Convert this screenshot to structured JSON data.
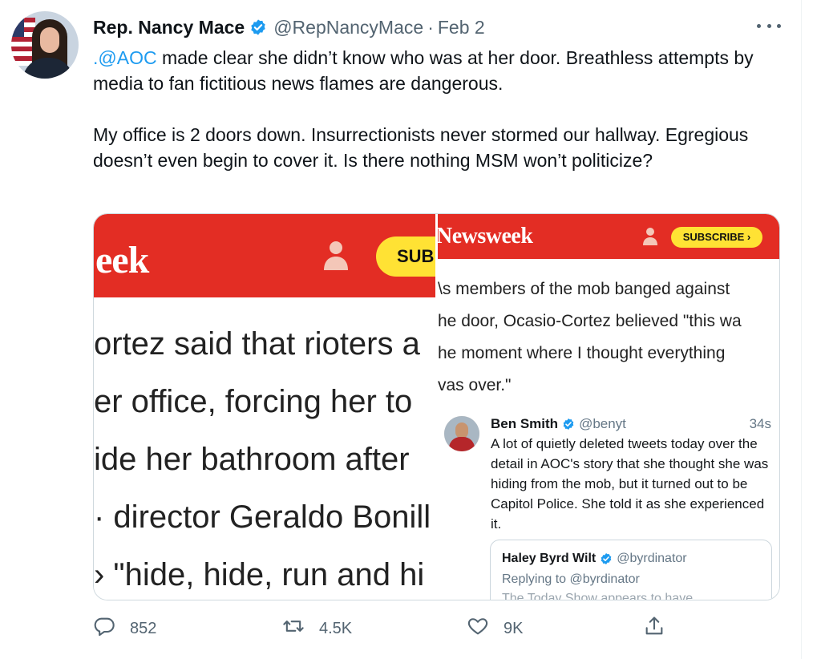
{
  "tweet": {
    "display_name": "Rep. Nancy Mace",
    "handle": "@RepNancyMace",
    "separator": "·",
    "date": "Feb 2",
    "mention": ".@AOC",
    "paragraph1_rest": " made clear she didn’t know who was at her door. Breathless attempts by media to fan fictitious news flames are dangerous.",
    "paragraph2": "My office is 2 doors down. Insurrectionists never stormed our hallway. Egregious doesn’t even begin to cover it. Is there nothing MSM won’t politicize?"
  },
  "media": {
    "left": {
      "logo": "eek",
      "subscribe": "SUB",
      "lines": [
        "ortez said that rioters a",
        "er office, forcing her to",
        "ide her bathroom after",
        "· director Geraldo Bonill",
        "› \"hide, hide, run and hi"
      ]
    },
    "right": {
      "logo": "Newsweek",
      "subscribe": "SUBSCRIBE ›",
      "lines": [
        "\\s members of the mob banged against",
        "he door, Ocasio-Cortez believed \"this wa",
        "he moment where I thought everything",
        "vas over.\""
      ],
      "embed": {
        "name": "Ben Smith",
        "handle": "@benyt",
        "time": "34s",
        "text": "A lot of quietly deleted tweets today over the detail in AOC's story that she thought she was hiding from the mob, but it turned out to be Capitol Police. She told it as she experienced it.",
        "quote": {
          "name": "Haley Byrd Wilt",
          "handle": "@byrdinator",
          "reply": "Replying to @byrdinator",
          "cut_text": "The Today Show appears to have"
        }
      }
    }
  },
  "actions": {
    "reply_count": "852",
    "retweet_count": "4.5K",
    "like_count": "9K",
    "reply_icon": "speech-bubble",
    "retweet_icon": "retweet-arrows",
    "like_icon": "heart-outline",
    "share_icon": "share-upload"
  },
  "colors": {
    "verified_blue": "#1d9bf0",
    "newsweek_red": "#e32d24",
    "subscribe_yellow": "#ffe234",
    "secondary_text": "#536471"
  }
}
